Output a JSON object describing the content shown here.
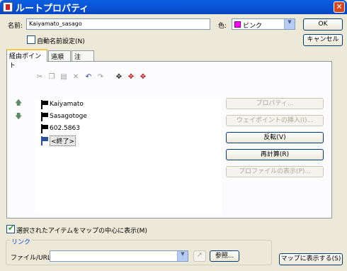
{
  "window": {
    "title": "ルートプロパティ",
    "close_glyph": "✕"
  },
  "form": {
    "name_label": "名前:",
    "name_value": "Kaiyamato_sasago",
    "color_label": "色:",
    "color_value": "ピンク",
    "color_swatch": "#ff00ff",
    "auto_name_label": "自動名前設定(N)",
    "auto_name_checked": false
  },
  "buttons": {
    "ok": "OK",
    "cancel": "キャンセル",
    "properties": "プロパティ...",
    "insert_waypoint": "ウェイポイントの挿入(I)...",
    "reverse": "反転(V)",
    "recalculate": "再計算(R)",
    "show_profile": "プロファイルの表示(P)...",
    "browse": "参照...",
    "show_on_map": "マップに表示する(S)"
  },
  "tabs": [
    {
      "label": "経由ポイント",
      "active": true
    },
    {
      "label": "道順",
      "active": false
    },
    {
      "label": "注",
      "active": false
    }
  ],
  "toolbar": {
    "icons": [
      "cut-icon",
      "copy-icon",
      "paste-icon",
      "delete-icon",
      "undo-icon",
      "redo-icon",
      "find-icon",
      "find-next-icon",
      "find-previous-icon"
    ],
    "glyphs": [
      "✂",
      "❐",
      "▤",
      "✕",
      "↶",
      "↷",
      "✥",
      "✥",
      "✥"
    ]
  },
  "waypoints": [
    {
      "name": "Kaiyamato",
      "selected": false
    },
    {
      "name": "Sasagotoge",
      "selected": false
    },
    {
      "name": "602.5863",
      "selected": false
    },
    {
      "name": "<終了>",
      "selected": true
    }
  ],
  "nav_arrows": {
    "up": "🡅",
    "down": "🡇"
  },
  "center_on_map": {
    "label": "選択されたアイテムをマップの中心に表示(M)",
    "checked": true
  },
  "link": {
    "group_title": "リンク",
    "file_url_label": "ファイル/URL:",
    "value": "",
    "go_glyph": "➚"
  }
}
